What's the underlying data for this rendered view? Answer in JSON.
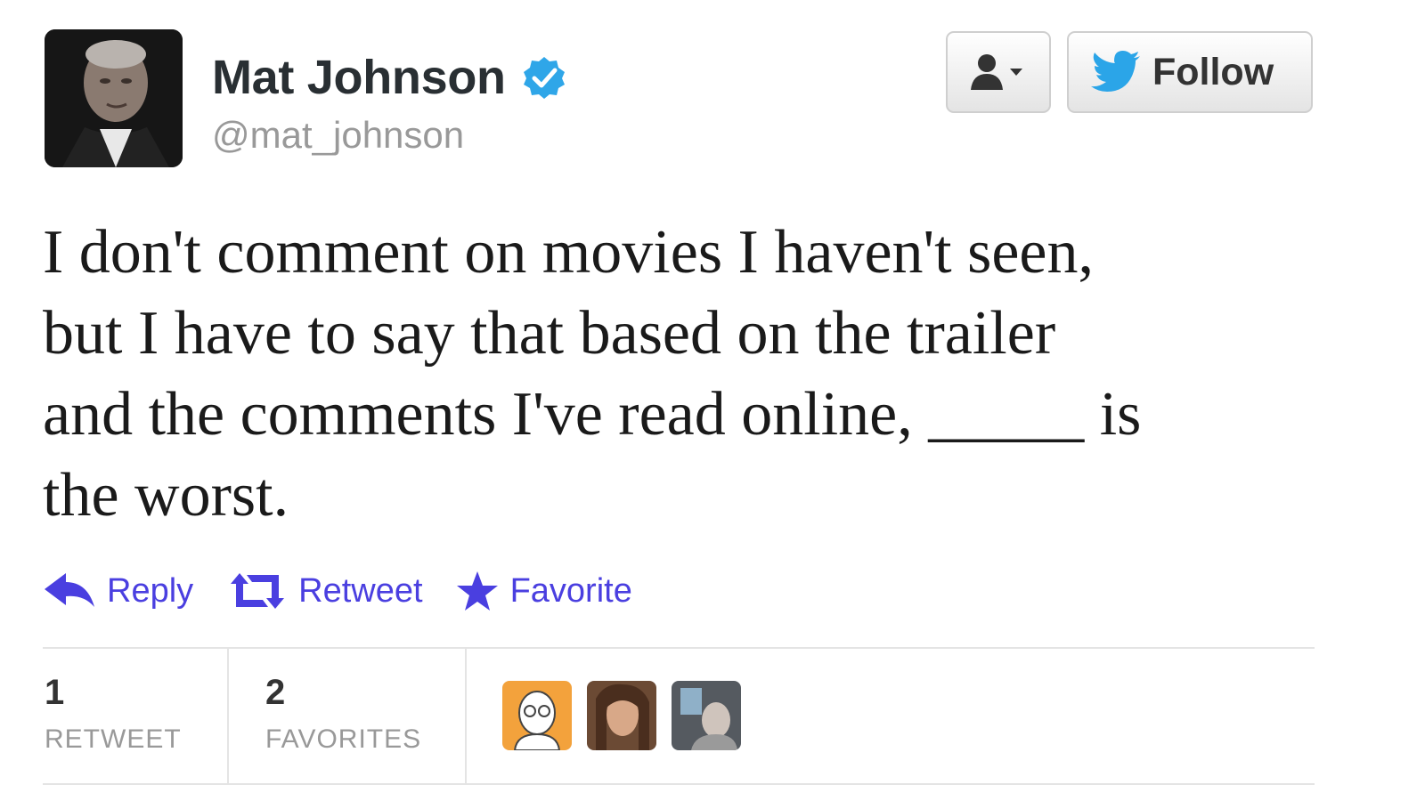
{
  "profile": {
    "display_name": "Mat Johnson",
    "handle": "@mat_johnson",
    "verified_icon": "verified-badge-icon"
  },
  "buttons": {
    "user_actions_icon": "user-dropdown-icon",
    "follow_label": "Follow",
    "follow_icon": "twitter-bird-icon"
  },
  "tweet": {
    "lines": [
      "I don't comment on movies I haven't seen,",
      "but I have to say that based on the trailer",
      "and the comments I've read online, _____ is",
      "the worst."
    ]
  },
  "actions": {
    "reply_label": "Reply",
    "retweet_label": "Retweet",
    "favorite_label": "Favorite"
  },
  "stats": {
    "retweets_count": "1",
    "retweets_label": "RETWEET",
    "favorites_count": "2",
    "favorites_label": "FAVORITES"
  },
  "colors": {
    "action_link": "#4a3fe0",
    "verified_blue": "#2fa6e8",
    "twitter_blue": "#2ba5e8",
    "text_dark": "#333333",
    "muted_gray": "#999999"
  }
}
